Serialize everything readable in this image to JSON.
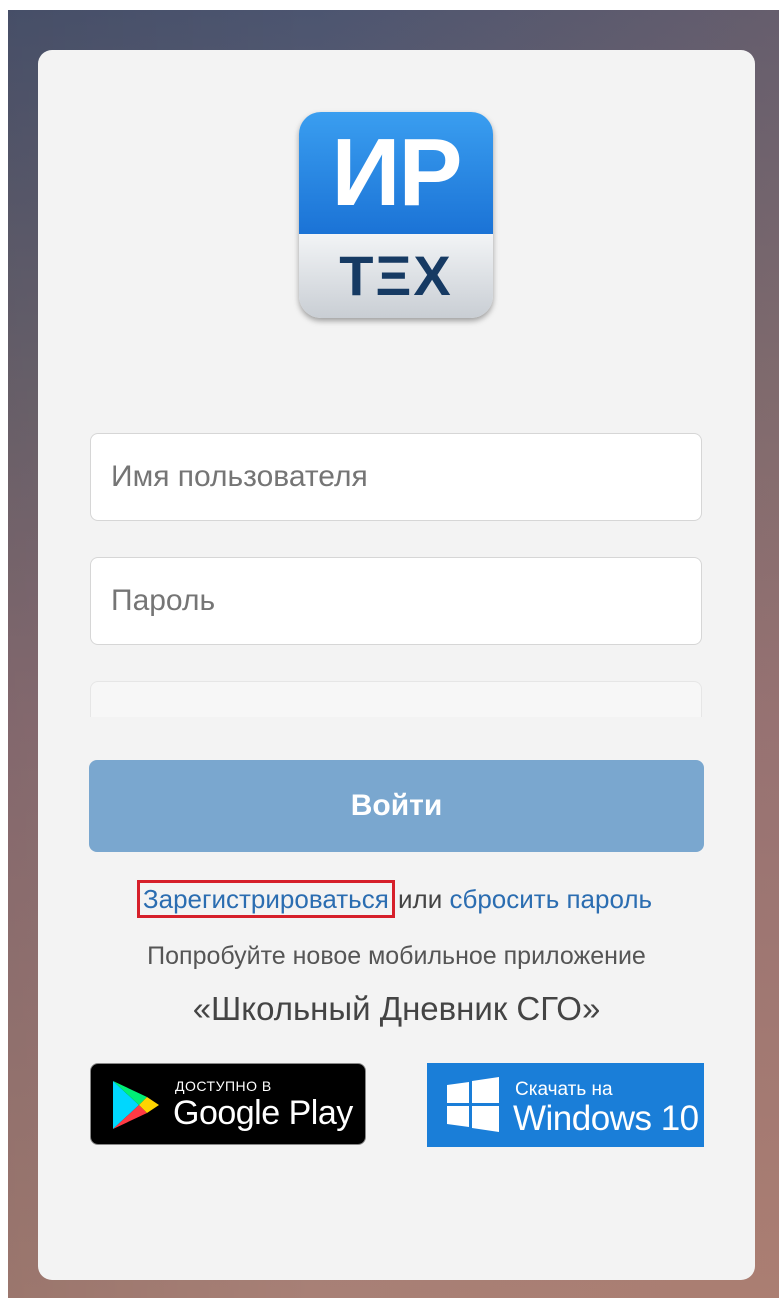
{
  "logo": {
    "top_text": "ИР",
    "bottom_text": "ТΞХ"
  },
  "form": {
    "username_placeholder": "Имя пользователя",
    "password_placeholder": "Пароль",
    "login_label": "Войти"
  },
  "links": {
    "register": "Зарегистрироваться",
    "or": " или ",
    "reset_password": "сбросить пароль"
  },
  "promo": {
    "try_text": "Попробуйте новое мобильное приложение",
    "app_name": "«Школьный Дневник СГО»"
  },
  "stores": {
    "google_small": "ДОСТУПНО В",
    "google_big": "Google Play",
    "windows_small": "Скачать на",
    "windows_big": "Windows 10"
  },
  "colors": {
    "accent": "#7aa7cf",
    "link": "#2b6db1",
    "highlight": "#d6202a",
    "windows_blue": "#1a7ed8"
  },
  "icons": [
    "google-play-icon",
    "windows-icon"
  ]
}
